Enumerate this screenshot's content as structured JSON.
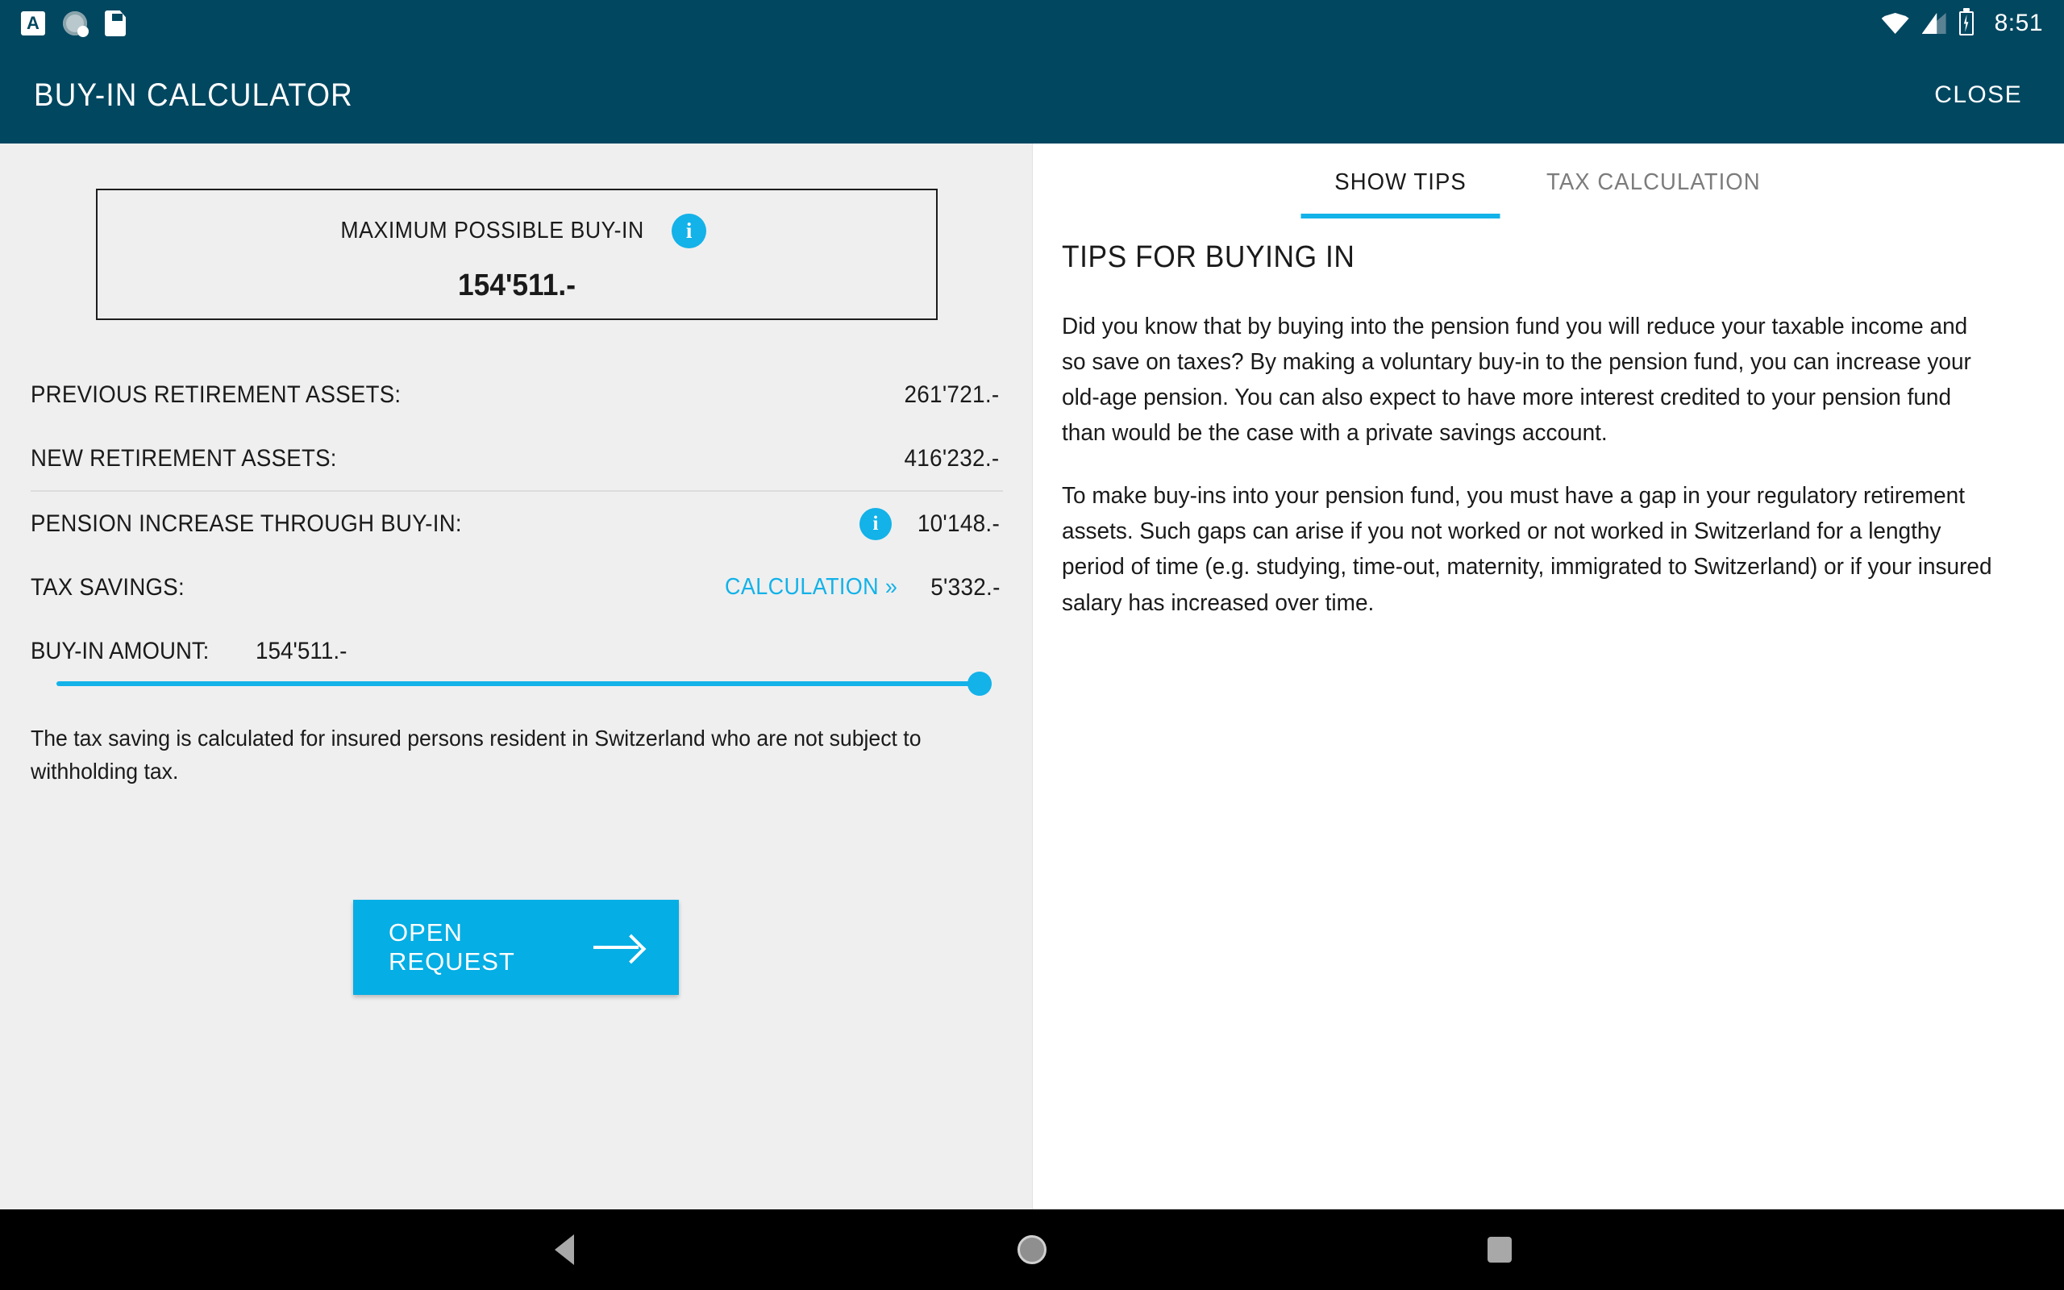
{
  "statusbar": {
    "icons_left": [
      "ime-keyboard-icon",
      "sync-icon",
      "sd-card-icon"
    ],
    "icons_right": [
      "wifi-icon",
      "signal-icon",
      "battery-charging-icon"
    ],
    "time": "8:51"
  },
  "appbar": {
    "title": "BUY-IN CALCULATOR",
    "close_label": "CLOSE",
    "background": "#014760"
  },
  "theme": {
    "accent": "#13b2e8",
    "cta": "#05aee4",
    "panel_bg": "#efeff0",
    "right_bg": "#ffffff"
  },
  "max_buyin": {
    "label": "MAXIMUM POSSIBLE BUY-IN",
    "info_glyph": "i",
    "value": "154'511.-"
  },
  "rows": [
    {
      "label": "PREVIOUS RETIREMENT ASSETS:",
      "value": "261'721.-"
    },
    {
      "label": "NEW RETIREMENT ASSETS:",
      "value": "416'232.-"
    },
    {
      "label": "PENSION INCREASE THROUGH BUY-IN:",
      "value": "10'148.-",
      "info_glyph": "i"
    },
    {
      "label": "TAX SAVINGS:",
      "value": "5'332.-",
      "link": "CALCULATION »"
    }
  ],
  "buyin_amount": {
    "label": "BUY-IN AMOUNT:",
    "value": "154'511.-",
    "slider_percent": 100
  },
  "disclaimer": {
    "line1": "The tax saving is calculated for insured persons resident in Switzerland who are not subject to",
    "line2": "withholding tax."
  },
  "cta": {
    "label": "OPEN REQUEST",
    "icon": "arrow-right-icon"
  },
  "right": {
    "tabs": [
      {
        "label": "SHOW TIPS",
        "active": true
      },
      {
        "label": "TAX CALCULATION",
        "active": false
      }
    ],
    "tips_title": "TIPS FOR BUYING IN",
    "paragraphs": [
      "Did you know that by buying into the pension fund you will reduce your taxable income and so save on taxes? By making a voluntary buy-in to the pension fund, you can increase your old-age pension. You can also expect to have more interest credited to your pension fund than would be the case with a private savings account.",
      "To make buy-ins into your pension fund, you must have a gap in your regulatory retirement assets. Such gaps can arise if you not worked or not worked in Switzerland for a lengthy period of time (e.g. studying, time-out, maternity, immigrated to Switzerland) or if your insured salary has increased over time."
    ]
  },
  "navbar": {
    "back": "back-icon",
    "home": "home-icon",
    "recents": "recents-icon"
  }
}
